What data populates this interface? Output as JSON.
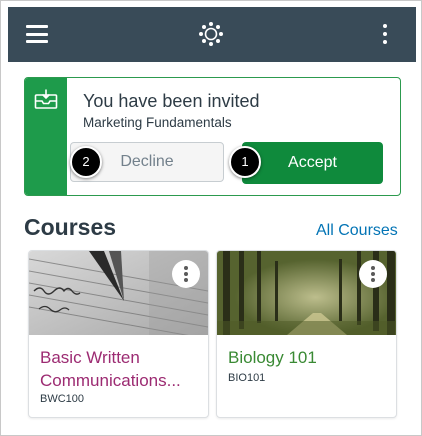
{
  "topbar": {
    "menu_icon": "hamburger-menu-icon",
    "logo_icon": "canvas-logo-icon",
    "more_icon": "kebab-menu-icon",
    "background": "#394b58"
  },
  "invitation": {
    "icon": "invitation-icon",
    "title": "You have been invited",
    "course_name": "Marketing Fundamentals",
    "decline_label": "Decline",
    "accept_label": "Accept",
    "callouts": [
      "2",
      "1"
    ],
    "accent": "#1e9b4b"
  },
  "courses": {
    "heading": "Courses",
    "all_courses_link": "All Courses",
    "cards": [
      {
        "name_line1": "Basic Written",
        "name_line2": "Communications...",
        "code": "BWC100",
        "color": "#9c2b72",
        "image": "fountain-pen-writing-image"
      },
      {
        "name_line1": "Biology 101",
        "code": "BIO101",
        "color": "#3a8a34",
        "image": "forest-path-image"
      }
    ]
  }
}
